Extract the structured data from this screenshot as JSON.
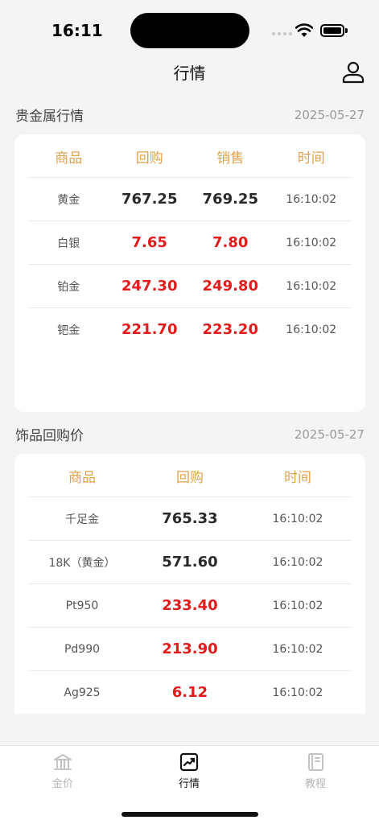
{
  "status": {
    "time": "16:11"
  },
  "nav": {
    "title": "行情"
  },
  "metals": {
    "title": "贵金属行情",
    "date": "2025-05-27",
    "headers": {
      "product": "商品",
      "buyback": "回购",
      "sell": "销售",
      "time": "时间"
    },
    "rows": [
      {
        "name": "黄金",
        "buyback": "767.25",
        "sell": "769.25",
        "time": "16:10:02",
        "highlight": false
      },
      {
        "name": "白银",
        "buyback": "7.65",
        "sell": "7.80",
        "time": "16:10:02",
        "highlight": true
      },
      {
        "name": "铂金",
        "buyback": "247.30",
        "sell": "249.80",
        "time": "16:10:02",
        "highlight": true
      },
      {
        "name": "钯金",
        "buyback": "221.70",
        "sell": "223.20",
        "time": "16:10:02",
        "highlight": true
      }
    ]
  },
  "jewelry": {
    "title": "饰品回购价",
    "date": "2025-05-27",
    "headers": {
      "product": "商品",
      "buyback": "回购",
      "time": "时间"
    },
    "rows": [
      {
        "name": "千足金",
        "buyback": "765.33",
        "time": "16:10:02",
        "highlight": false
      },
      {
        "name": "18K（黄金）",
        "buyback": "571.60",
        "time": "16:10:02",
        "highlight": false
      },
      {
        "name": "Pt950",
        "buyback": "233.40",
        "time": "16:10:02",
        "highlight": true
      },
      {
        "name": "Pd990",
        "buyback": "213.90",
        "time": "16:10:02",
        "highlight": true
      },
      {
        "name": "Ag925",
        "buyback": "6.12",
        "time": "16:10:02",
        "highlight": true
      }
    ]
  },
  "tabs": [
    {
      "label": "金价",
      "icon": "bank-icon",
      "active": false
    },
    {
      "label": "行情",
      "icon": "trend-chart-icon",
      "active": true
    },
    {
      "label": "教程",
      "icon": "book-icon",
      "active": false
    }
  ],
  "colors": {
    "accent": "#e0a24a",
    "rise": "#e21b1b",
    "text": "#2a2a2a"
  }
}
